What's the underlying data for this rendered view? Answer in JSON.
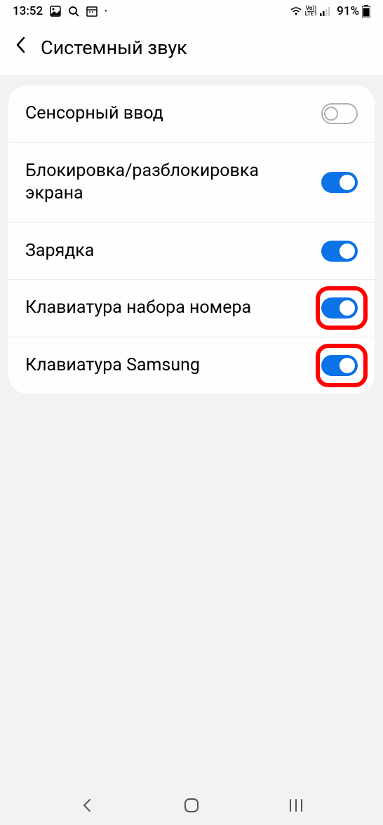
{
  "status_bar": {
    "time": "13:52",
    "battery_percent": "91%"
  },
  "header": {
    "title": "Системный звук"
  },
  "settings": [
    {
      "label": "Сенсорный ввод",
      "enabled": false,
      "highlighted": false
    },
    {
      "label": "Блокировка/разблокировка экрана",
      "enabled": true,
      "highlighted": false
    },
    {
      "label": "Зарядка",
      "enabled": true,
      "highlighted": false
    },
    {
      "label": "Клавиатура набора номера",
      "enabled": true,
      "highlighted": true
    },
    {
      "label": "Клавиатура Samsung",
      "enabled": true,
      "highlighted": true
    }
  ]
}
